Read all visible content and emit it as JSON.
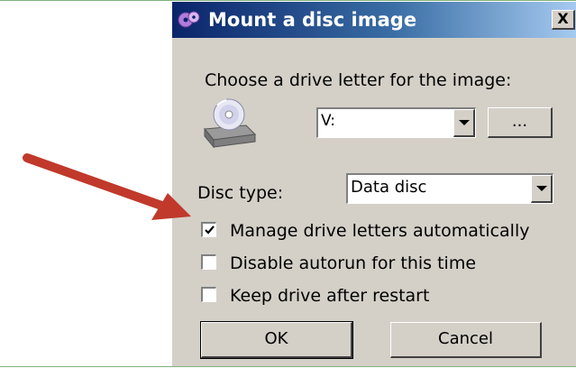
{
  "dialog": {
    "title": "Mount a disc image",
    "close_label": "X",
    "title_icon": "disc-mount-app-icon"
  },
  "drive": {
    "prompt": "Choose a drive letter for the image:",
    "icon": "cd-drive-icon",
    "selected": "V:",
    "browse_label": "..."
  },
  "disc_type": {
    "label": "Disc type:",
    "selected": "Data disc"
  },
  "options": [
    {
      "label": "Manage drive letters automatically",
      "checked": true
    },
    {
      "label": "Disable autorun for this time",
      "checked": false
    },
    {
      "label": "Keep drive after restart",
      "checked": false
    }
  ],
  "buttons": {
    "ok": "OK",
    "cancel": "Cancel"
  },
  "annotation": {
    "icon": "red-pointer-arrow",
    "color": "#c0392b"
  },
  "colors": {
    "title_gradient_start": "#0a246a",
    "title_gradient_end": "#a6caf0",
    "dialog_face": "#d4d0c8"
  }
}
